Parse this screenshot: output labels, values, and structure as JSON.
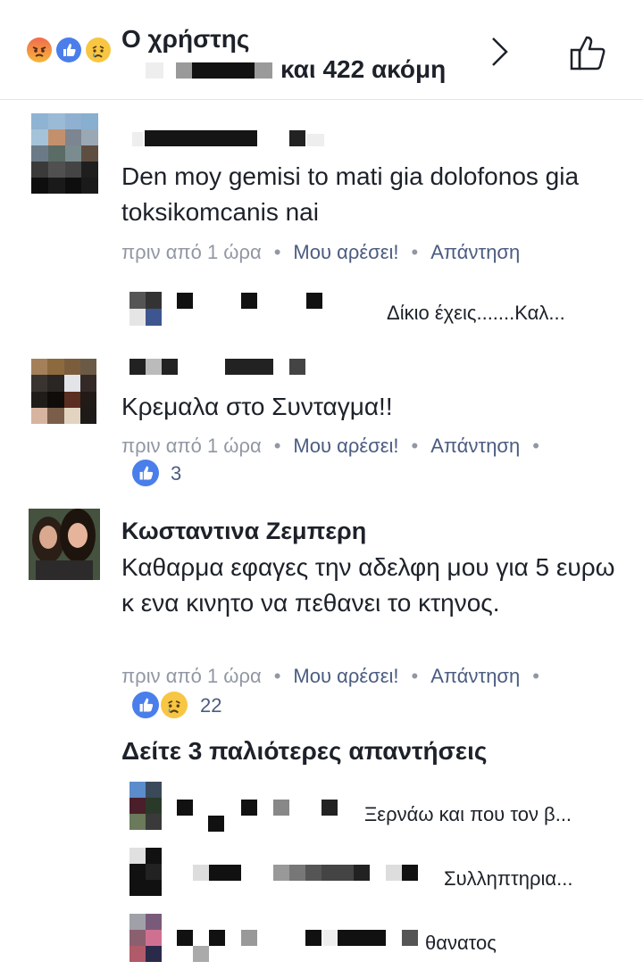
{
  "header": {
    "title": "Ο χρήστης",
    "others_text": "και 422 ακόμη",
    "reaction_icons": [
      "angry-icon",
      "like-icon",
      "sad-icon"
    ]
  },
  "comments": [
    {
      "name": "",
      "text": "Den moy gemisi to mati gia dolofonos gia toksikomcanis nai",
      "time": "πριν από 1 ώρα",
      "like": "Μου αρέσει!",
      "reply": "Απάντηση",
      "reply_preview": "Δίκιο έχεις.......Καλ..."
    },
    {
      "name": "",
      "text": "Κρεμαλα στο Συνταγμα!!",
      "time": "πριν από 1 ώρα",
      "like": "Μου αρέσει!",
      "reply": "Απάντηση",
      "reaction_count": "3"
    },
    {
      "name": "Κωσταντινα Ζεμπερη",
      "text": "Καθαρμα εφαγες την αδελφη μου για 5 ευρω κ ενα κινητο να πεθανει το κτηνος.",
      "time": "πριν από 1 ώρα",
      "like": "Μου αρέσει!",
      "reply": "Απάντηση",
      "reaction_count": "22",
      "see_older": "Δείτε 3 παλιότερες απαντήσεις",
      "replies": [
        {
          "text": "Ξερνάω και που τον β..."
        },
        {
          "text": "Συλληπτηρια..."
        },
        {
          "text": "θανατος"
        }
      ]
    }
  ],
  "colors": {
    "link": "#4b5c81",
    "meta": "#9197a3",
    "like_blue": "#4a7eea"
  }
}
